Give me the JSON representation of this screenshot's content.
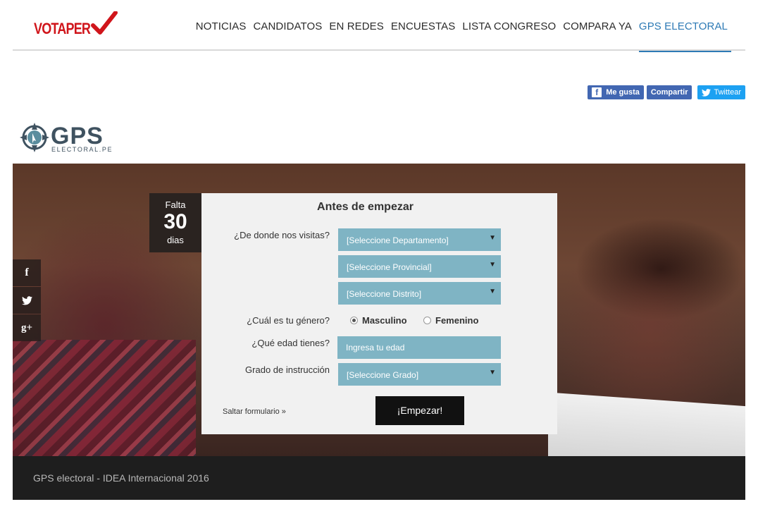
{
  "header": {
    "logo_text": "VOTAPER",
    "nav": [
      {
        "label": "NOTICIAS"
      },
      {
        "label": "CANDIDATOS"
      },
      {
        "label": "EN REDES"
      },
      {
        "label": "ENCUESTAS"
      },
      {
        "label": "LISTA CONGRESO"
      },
      {
        "label": "COMPARA YA"
      },
      {
        "label": "GPS ELECTORAL"
      }
    ],
    "active_nav": "GPS ELECTORAL",
    "accent_color": "#2d7ab5",
    "brand_color": "#d0151b"
  },
  "share": {
    "like_label": "Me gusta",
    "share_label": "Compartir",
    "tweet_label": "Twittear"
  },
  "gps_logo": {
    "word": "GPS",
    "sub": "ELECTORAL.PE"
  },
  "counter": {
    "label_top": "Falta",
    "number": "30",
    "label_bottom": "dias"
  },
  "side_social": {
    "items": [
      {
        "icon": "facebook-icon",
        "glyph": "f"
      },
      {
        "icon": "twitter-icon",
        "glyph": "t"
      },
      {
        "icon": "google-plus-icon",
        "glyph": "g+"
      }
    ]
  },
  "form": {
    "title": "Antes de empezar",
    "location_label": "¿De donde nos visitas?",
    "department_select": "[Seleccione Departamento]",
    "province_select": "[Seleccione Provincial]",
    "district_select": "[Seleccione Distrito]",
    "gender_label": "¿Cuál es tu género?",
    "gender_options": [
      "Masculino",
      "Femenino"
    ],
    "gender_selected": "Masculino",
    "age_label": "¿Qué edad tienes?",
    "age_placeholder": "Ingresa tu edad",
    "education_label": "Grado de instrucción",
    "education_select": "[Seleccione Grado]",
    "skip_label": "Saltar formulario »",
    "start_label": "¡Empezar!",
    "field_color": "#7fb4c4"
  },
  "footer": {
    "text": "GPS electoral - IDEA Internacional 2016"
  }
}
